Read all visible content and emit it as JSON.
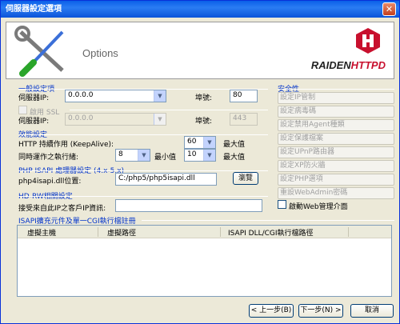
{
  "window": {
    "title": "伺服器設定選項",
    "close": "✕"
  },
  "banner": {
    "heading": "Options",
    "brand_prefix": "RAIDEN",
    "brand_suffix": "HTTPD"
  },
  "general": {
    "title": "一般設定項",
    "server_ip_label": "伺服器IP:",
    "server_ip_value": "0.0.0.0",
    "port_label": "埠號:",
    "port_value": "80"
  },
  "ssl": {
    "enable_label": "啟用 SSL",
    "server_ip_label": "伺服器IP:",
    "server_ip_value": "0.0.0.0",
    "port_label": "埠號:",
    "port_value": "443"
  },
  "performance": {
    "title": "效能設定",
    "keepalive_label": "HTTP 持續作用 (KeepAlive):",
    "keepalive_value": "60",
    "keepalive_unit": "最大值",
    "threads_label": "同時運作之執行緒:",
    "threads_min_value": "8",
    "threads_min_label": "最小值",
    "threads_max_value": "10",
    "threads_max_label": "最大值"
  },
  "php": {
    "title": "PHP ISAPI 處理器設定 (4.x-5.x)",
    "dll_label": "php4isapi.dll位置:",
    "dll_value": "C:/php5/php5isapi.dll",
    "browse": "瀏覽"
  },
  "hdrw": {
    "title": "HD-RW相關設定",
    "accept_label": "接受來自此IP之客戶IP資訊:",
    "accept_value": ""
  },
  "security": {
    "title": "安全性",
    "buttons": [
      "設定IP管制",
      "設定病毒碼",
      "設定禁用Agent種類",
      "設定保護檔案",
      "設定UPnP路由器",
      "設定XP防火牆",
      "設定PHP選項",
      "重設WebAdmin密碼"
    ],
    "webadmin_label": "啟動Web管理介面"
  },
  "isapi": {
    "title": "ISAPI擴充元件及單一CGI執行檔註冊",
    "columns": [
      "虛擬主機",
      "虛擬路徑",
      "ISAPI DLL/CGI執行檔路徑"
    ]
  },
  "footer": {
    "prev": "< 上一步(B)",
    "next": "下一步(N) >",
    "cancel": "取消"
  }
}
